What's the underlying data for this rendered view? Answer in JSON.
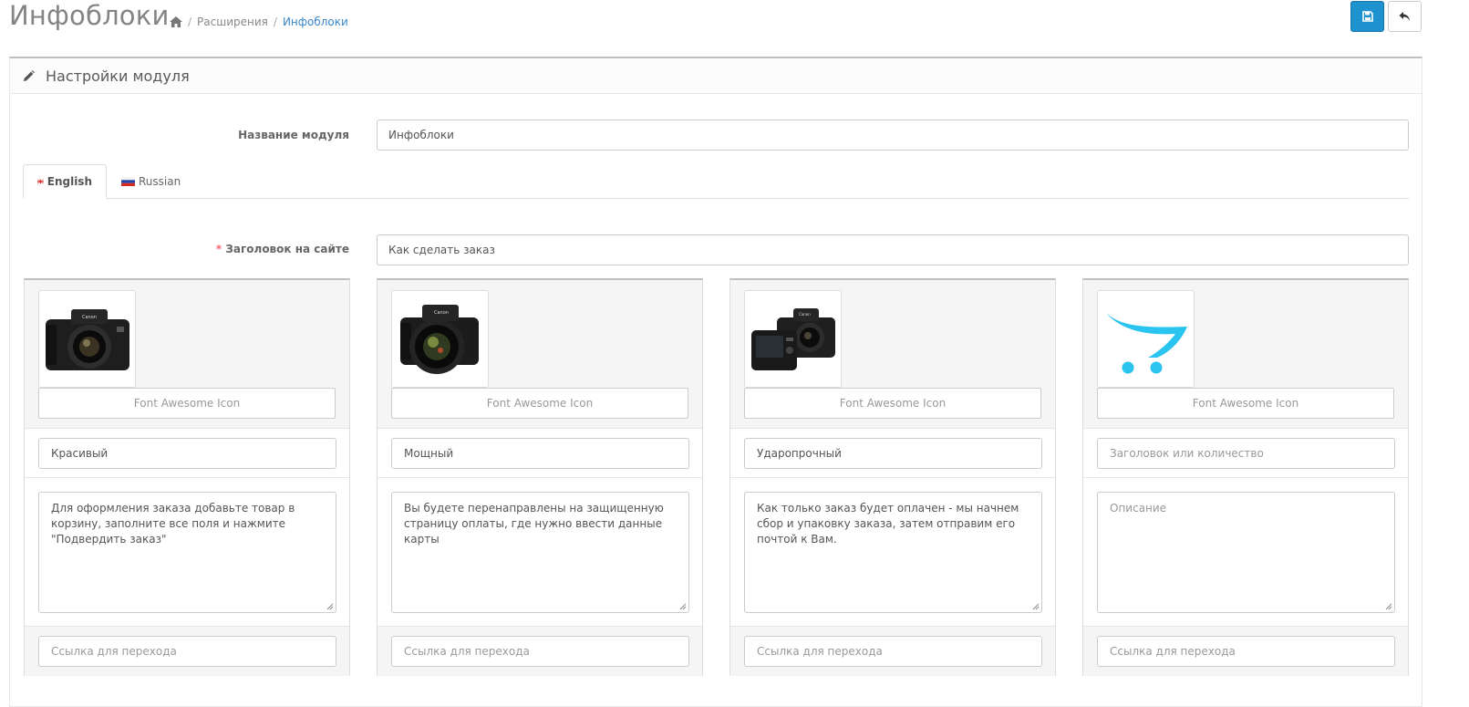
{
  "header": {
    "title": "Инфоблоки",
    "breadcrumb": [
      {
        "label": "Расширения"
      },
      {
        "label": "Инфоблоки"
      }
    ],
    "save_icon": "save-icon",
    "back_icon": "reply-icon"
  },
  "panel": {
    "heading": "Настройки модуля",
    "module_name_label": "Название модуля",
    "module_name_value": "Инфоблоки",
    "tabs": [
      {
        "label": "English"
      },
      {
        "label": "Russian"
      }
    ],
    "site_title_required": "*",
    "site_title_label": "Заголовок на сайте",
    "site_title_value": "Как сделать заказ"
  },
  "cards": [
    {
      "image": "camera-icon",
      "icon_placeholder": "Font Awesome Icon",
      "title": "Красивый",
      "description": "Для оформления заказа добавьте товар в корзину, заполните все поля и нажмите \"Подвердить заказ\"",
      "link_placeholder": "Ссылка для перехода"
    },
    {
      "image": "camera-icon",
      "icon_placeholder": "Font Awesome Icon",
      "title": "Мощный",
      "description": "Вы будете перенаправлены на защищенную страницу оплаты, где нужно ввести данные карты",
      "link_placeholder": "Ссылка для перехода"
    },
    {
      "image": "camera-icon",
      "icon_placeholder": "Font Awesome Icon",
      "title": "Ударопрочный",
      "description": "Как только заказ будет оплачен - мы начнем сбор и упаковку заказа, затем отправим его почтой к Вам.",
      "link_placeholder": "Ссылка для перехода"
    },
    {
      "image": "cart-logo",
      "icon_placeholder": "Font Awesome Icon",
      "title_placeholder": "Заголовок или количество",
      "description_placeholder": "Описание",
      "link_placeholder": "Ссылка для перехода"
    }
  ],
  "colors": {
    "primary": "#1e91cf",
    "link": "#3a87c9",
    "required": "#f56b6b",
    "cart_logo": "#29c4f0"
  }
}
